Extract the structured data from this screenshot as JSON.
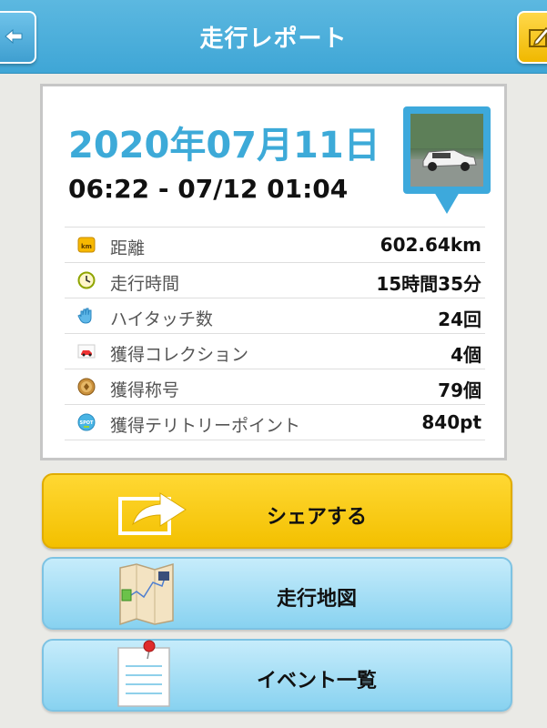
{
  "header": {
    "title": "走行レポート",
    "back_icon": "back-arrow-icon",
    "edit_icon": "edit-icon",
    "accent": "#3fa6d6"
  },
  "report": {
    "date": "2020年07月11日",
    "time_range": "06:22 - 07/12 01:04",
    "thumbnail": "car-photo-map-pin",
    "rows": [
      {
        "icon": "km-icon",
        "label": "距離",
        "value": "602.64km"
      },
      {
        "icon": "clock-icon",
        "label": "走行時間",
        "value": "15時間35分"
      },
      {
        "icon": "hand-icon",
        "label": "ハイタッチ数",
        "value": "24回"
      },
      {
        "icon": "car-icon",
        "label": "獲得コレクション",
        "value": "4個"
      },
      {
        "icon": "medal-icon",
        "label": "獲得称号",
        "value": "79個"
      },
      {
        "icon": "spot-icon",
        "label": "獲得テリトリーポイント",
        "value": "840pt"
      }
    ],
    "km_badge": "km",
    "spot_badge": "SPOT"
  },
  "actions": {
    "share": {
      "label": "シェアする",
      "icon": "share-icon",
      "color": "#f3c000"
    },
    "map": {
      "label": "走行地図",
      "icon": "map-icon",
      "color": "#88d2f0"
    },
    "events": {
      "label": "イベント一覧",
      "icon": "list-pin-icon",
      "color": "#88d2f0"
    }
  }
}
